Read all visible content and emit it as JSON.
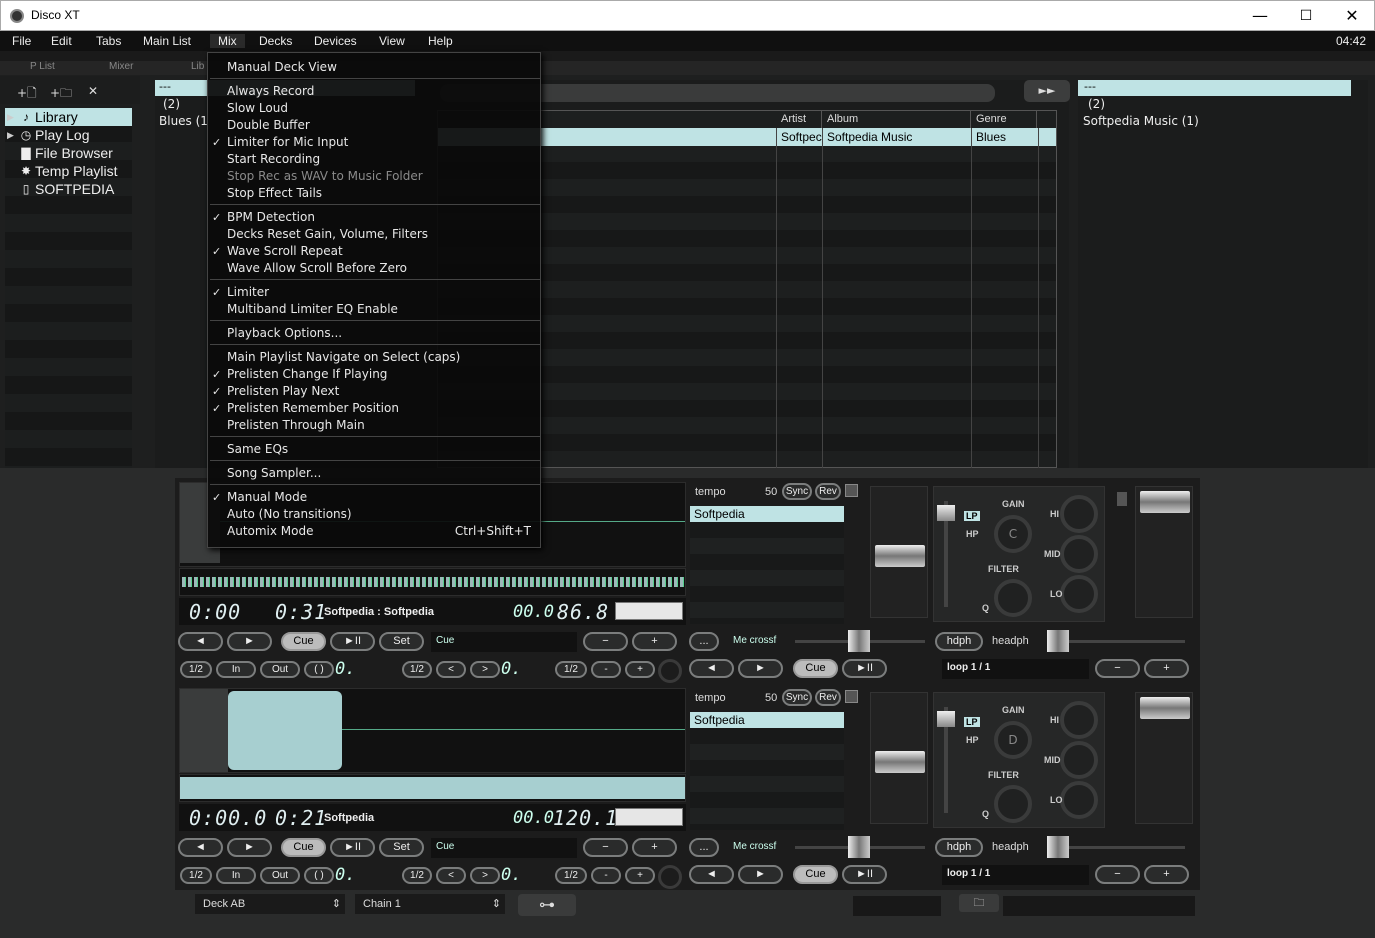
{
  "window": {
    "title": "Disco XT",
    "min": "—",
    "max": "☐",
    "close": "✕"
  },
  "menu": [
    "File",
    "Edit",
    "Tabs",
    "Main List",
    "Mix",
    "Decks",
    "Devices",
    "View",
    "Help"
  ],
  "clock": "04:42",
  "tabs": {
    "plist": "P List",
    "mixer": "Mixer",
    "lib": "Lib"
  },
  "toolbar": {
    "add_list": "+🗋",
    "add_folder": "+🗀",
    "remove": "✕"
  },
  "tree": [
    {
      "label": "Library",
      "icon": "♪",
      "arrow": "▶"
    },
    {
      "label": "Play Log",
      "icon": "◷",
      "arrow": "▶"
    },
    {
      "label": "File Browser",
      "icon": "▇",
      "arrow": ""
    },
    {
      "label": "Temp Playlist",
      "icon": "✸",
      "arrow": ""
    },
    {
      "label": "SOFTPEDIA",
      "icon": "▯",
      "arrow": ""
    }
  ],
  "col2": {
    "header": "---",
    "count": "(2)",
    "genre": "Blues (1"
  },
  "main_table": {
    "play_btn": "►►",
    "headers": {
      "artist": "Artist",
      "album": "Album",
      "genre": "Genre"
    },
    "row": {
      "artist": "Softpec",
      "album": "Softpedia Music",
      "genre": "Blues"
    }
  },
  "right": {
    "header": "---",
    "count": "(2)",
    "album": "Softpedia Music (1)"
  },
  "mix_menu": {
    "groups": [
      [
        {
          "label": "Manual Deck View",
          "checked": false,
          "disabled": false
        }
      ],
      [
        {
          "label": "Always Record",
          "checked": false,
          "disabled": false
        },
        {
          "label": "Slow Loud",
          "checked": false,
          "disabled": false
        },
        {
          "label": "Double Buffer",
          "checked": false,
          "disabled": false
        },
        {
          "label": "Limiter for Mic Input",
          "checked": true,
          "disabled": false
        },
        {
          "label": "Start Recording",
          "checked": false,
          "disabled": false
        },
        {
          "label": "Stop Rec as WAV to Music Folder",
          "checked": false,
          "disabled": true
        },
        {
          "label": "Stop Effect Tails",
          "checked": false,
          "disabled": false
        }
      ],
      [
        {
          "label": "BPM Detection",
          "checked": true,
          "disabled": false
        },
        {
          "label": "Decks Reset Gain, Volume, Filters",
          "checked": false,
          "disabled": false
        },
        {
          "label": "Wave Scroll Repeat",
          "checked": true,
          "disabled": false
        },
        {
          "label": "Wave Allow Scroll Before Zero",
          "checked": false,
          "disabled": false
        }
      ],
      [
        {
          "label": "Limiter",
          "checked": true,
          "disabled": false
        },
        {
          "label": "Multiband Limiter EQ Enable",
          "checked": false,
          "disabled": false
        }
      ],
      [
        {
          "label": "Playback Options...",
          "checked": false,
          "disabled": false
        }
      ],
      [
        {
          "label": "Main Playlist Navigate on Select (caps)",
          "checked": false,
          "disabled": false
        },
        {
          "label": "Prelisten Change If Playing",
          "checked": true,
          "disabled": false
        },
        {
          "label": "Prelisten Play Next",
          "checked": true,
          "disabled": false
        },
        {
          "label": "Prelisten Remember Position",
          "checked": true,
          "disabled": false
        },
        {
          "label": "Prelisten Through Main",
          "checked": false,
          "disabled": false
        }
      ],
      [
        {
          "label": "Same EQs",
          "checked": false,
          "disabled": false
        }
      ],
      [
        {
          "label": "Song Sampler...",
          "checked": false,
          "disabled": false
        }
      ],
      [
        {
          "label": "Manual Mode",
          "checked": true,
          "disabled": false
        },
        {
          "label": "Auto (No transitions)",
          "checked": false,
          "disabled": false
        },
        {
          "label": "Automix Mode",
          "checked": false,
          "disabled": false,
          "shortcut": "Ctrl+Shift+T"
        }
      ]
    ]
  },
  "decks": [
    {
      "elapsed": "0:00",
      "remain": "0:31",
      "track": "Softpedia : Softpedia",
      "pitch": "00.0",
      "bpm": "86.8",
      "tempo_label": "tempo",
      "tempo_value": "50",
      "sync": "Sync",
      "rev": "Rev",
      "playlist_item": "Softpedia",
      "eq": {
        "gain": "GAIN",
        "knob": "C",
        "filter": "FILTER",
        "hi": "HI",
        "mid": "MID",
        "lo": "LO",
        "lp": "LP",
        "hp": "HP",
        "q": "Q"
      },
      "row1": {
        "prev": "◄",
        "next": "►",
        "cue": "Cue",
        "playpause": "►II",
        "set": "Set",
        "cue_field": "Cue",
        "minus": "−",
        "plus": "+",
        "more": "...",
        "crossf": "Me crossf",
        "hdph": "hdph",
        "headph": "headph"
      },
      "row2": {
        "half": "1/2",
        "in": "In",
        "out": "Out",
        "loop": "( )",
        "loop_val": "0.",
        "half2": "1/2",
        "lt": "<",
        "gt": ">",
        "val2": "0.",
        "half3": "1/2",
        "m": "-",
        "p": "+",
        "prev": "◄",
        "next": "►",
        "cue": "Cue",
        "playpause": "►II",
        "loop_field": "loop 1 / 1",
        "minus": "−",
        "plus": "+"
      }
    },
    {
      "elapsed": "0:00.0",
      "remain": "0:21",
      "track": "Softpedia",
      "pitch": "00.0",
      "bpm": "120.1",
      "tempo_label": "tempo",
      "tempo_value": "50",
      "sync": "Sync",
      "rev": "Rev",
      "playlist_item": "Softpedia",
      "eq": {
        "gain": "GAIN",
        "knob": "D",
        "filter": "FILTER",
        "hi": "HI",
        "mid": "MID",
        "lo": "LO",
        "lp": "LP",
        "hp": "HP",
        "q": "Q"
      },
      "row1": {
        "prev": "◄",
        "next": "►",
        "cue": "Cue",
        "playpause": "►II",
        "set": "Set",
        "cue_field": "Cue",
        "minus": "−",
        "plus": "+",
        "more": "...",
        "crossf": "Me crossf",
        "hdph": "hdph",
        "headph": "headph"
      },
      "row2": {
        "half": "1/2",
        "in": "In",
        "out": "Out",
        "loop": "( )",
        "loop_val": "0.",
        "half2": "1/2",
        "lt": "<",
        "gt": ">",
        "val2": "0.",
        "half3": "1/2",
        "m": "-",
        "p": "+",
        "prev": "◄",
        "next": "►",
        "cue": "Cue",
        "playpause": "►II",
        "loop_field": "loop 1 / 1",
        "minus": "−",
        "plus": "+"
      }
    }
  ],
  "bottom": {
    "deck_select": "Deck AB",
    "chain_select": "Chain 1",
    "updown": "⇕",
    "link_icon": "⊶",
    "folder_icon": "🗀"
  },
  "colors": {
    "accent": "#bfe3e4",
    "background": "#1e1f1f"
  }
}
